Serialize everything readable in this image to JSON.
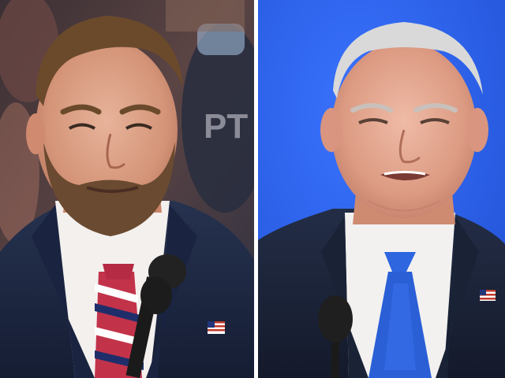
{
  "image": {
    "layout": "side-by-side",
    "divider_color": "#ffffff"
  },
  "left_panel": {
    "background_colors": [
      "#2b2a35",
      "#5a3a3a",
      "#1b2a4a"
    ],
    "suit_color": "#1d2a44",
    "tie_colors": [
      "#c2334a",
      "#ffffff",
      "#1f2e6b"
    ],
    "icons": [
      "microphone-icon",
      "flag-pin-icon"
    ]
  },
  "right_panel": {
    "background_color": "#2f5fe6",
    "suit_color": "#1b2439",
    "tie_color": "#2a5fd6",
    "icons": [
      "microphone-icon",
      "flag-pin-icon"
    ]
  }
}
